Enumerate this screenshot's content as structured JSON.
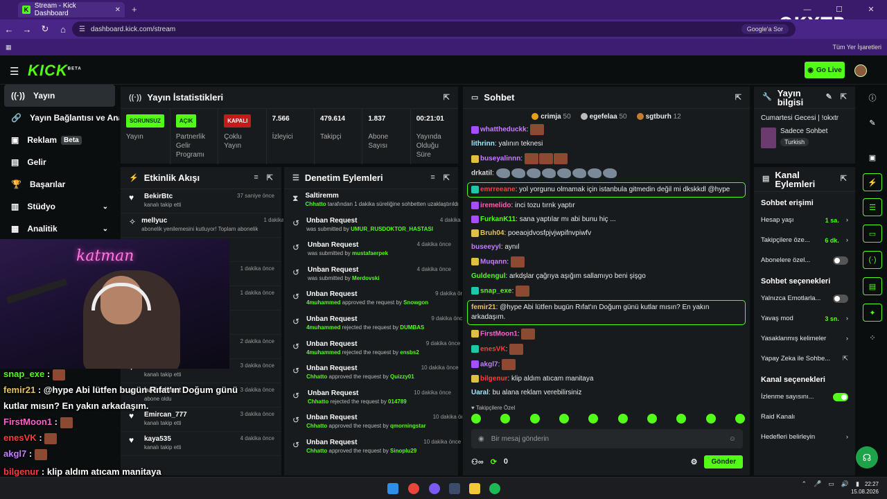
{
  "browser": {
    "tab_title": "Stream - Kick Dashboard",
    "url": "dashboard.kick.com/stream",
    "google_chip": "Google'a Sor",
    "bookmarks_label": "Tüm Yer İşaretleri"
  },
  "watermark": "OKXTR",
  "header": {
    "logo": "KICK",
    "logo_tag": "BETA",
    "go_live": "Go Live"
  },
  "nav": [
    {
      "label": "Yayın",
      "icon": "broadcast-icon"
    },
    {
      "label": "Yayın Bağlantısı ve Anahtarı",
      "icon": "link-icon"
    },
    {
      "label": "Reklam",
      "badge": "Beta",
      "icon": "ad-icon"
    },
    {
      "label": "Gelir",
      "icon": "revenue-icon"
    },
    {
      "label": "Başarılar",
      "icon": "trophy-icon"
    },
    {
      "label": "Stüdyo",
      "icon": "studio-icon"
    },
    {
      "label": "Analitik",
      "icon": "analytics-icon"
    }
  ],
  "stats": {
    "title": "Yayın İstatistikleri",
    "items": [
      {
        "value": "SORUNSUZ",
        "label": "Yayın",
        "pill": "green"
      },
      {
        "value": "AÇIK",
        "label": "Partnerlik Gelir Programı",
        "pill": "green"
      },
      {
        "value": "KAPALI",
        "label": "Çoklu Yayın",
        "pill": "red"
      },
      {
        "value": "7.566",
        "label": "İzleyici"
      },
      {
        "value": "479.614",
        "label": "Takipçi"
      },
      {
        "value": "1.837",
        "label": "Abone Sayısı"
      },
      {
        "value": "00:21:01",
        "label": "Yayında Olduğu Süre"
      }
    ]
  },
  "activity": {
    "title": "Etkinlik Akışı",
    "items": [
      {
        "name": "BekirBtc",
        "sub": "kanalı takip etti",
        "time": "37 saniye önce"
      },
      {
        "name": "mellyuc",
        "sub": "abonelik yenilemesini kutluyor! Toplam abonelik",
        "time": "1 dakika önce"
      },
      {
        "name": "",
        "sub": "",
        "time": ""
      },
      {
        "name": "",
        "sub": "",
        "time": "1 dakika önce"
      },
      {
        "name": "",
        "sub": "oplam abonelik",
        "time": "1 dakika önce"
      },
      {
        "name": "",
        "sub": "",
        "time": ""
      },
      {
        "name": "",
        "sub": "",
        "time": "2 dakika önce"
      },
      {
        "name": "Enamalol",
        "sub": "kanalı takip etti",
        "time": "3 dakika önce"
      },
      {
        "name": "barisahmet",
        "sub": "abone oldu",
        "time": "3 dakika önce"
      },
      {
        "name": "Emircan_777",
        "sub": "kanalı takip etti",
        "time": "3 dakika önce"
      },
      {
        "name": "kaya535",
        "sub": "kanalı takip etti",
        "time": "4 dakika önce"
      }
    ]
  },
  "moderation": {
    "title": "Denetim Eylemleri",
    "items": [
      {
        "title": "Saltiremm",
        "user": "Chhatto",
        "rest": " tarafından 1 dakika süreliğine sohbetten uzaklaştırıldı",
        "time": "2 dakika önce",
        "icon": "hourglass-icon"
      },
      {
        "title": "Unban Request",
        "pre": "was submitted by ",
        "user": "UMUR_RUSDOKTOR_HASTASI",
        "time": "4 dakika önce"
      },
      {
        "title": "Unban Request",
        "pre": "was submitted by ",
        "user": "mustafaerpek",
        "time": "4 dakika önce"
      },
      {
        "title": "Unban Request",
        "pre": "was submitted by ",
        "user": "Merdovski",
        "time": "4 dakika önce"
      },
      {
        "title": "Unban Request",
        "user": "4muhammed",
        "rest": " approved the request by ",
        "user2": "Snowgon",
        "time": "9 dakika önce"
      },
      {
        "title": "Unban Request",
        "user": "4muhammed",
        "rest": " rejected the request by ",
        "user2": "DUMBAS",
        "time": "9 dakika önce"
      },
      {
        "title": "Unban Request",
        "user": "4muhammed",
        "rest": " rejected the request by ",
        "user2": "ensbs2",
        "time": "9 dakika önce"
      },
      {
        "title": "Unban Request",
        "user": "Chhatto",
        "rest": " approved the request by ",
        "user2": "Quizzy01",
        "time": "10 dakika önce"
      },
      {
        "title": "Unban Request",
        "user": "Chhatto",
        "rest": " rejected the request by ",
        "user2": "014789",
        "time": "10 dakika önce"
      },
      {
        "title": "Unban Request",
        "user": "Chhatto",
        "rest": " approved the request by ",
        "user2": "qmorningstar",
        "time": "10 dakika önce"
      },
      {
        "title": "Unban Request",
        "user": "Chhatto",
        "rest": " approved the request by ",
        "user2": "Sinoplu29",
        "time": "10 dakika önce"
      }
    ]
  },
  "chat": {
    "title": "Sohbet",
    "pinned": [
      {
        "name": "crimja",
        "pts": "50"
      },
      {
        "name": "egefelaa",
        "pts": "50"
      },
      {
        "name": "sgtburh",
        "pts": "12"
      }
    ],
    "messages": [
      {
        "user": "whattheduckk",
        "color": "#c77dff",
        "text": "",
        "emotes": 1,
        "badge": "#a64dff"
      },
      {
        "user": "lithrinn",
        "color": "#9ee9ff",
        "text": "yalının teknesi"
      },
      {
        "user": "buseyalinnn",
        "color": "#c77dff",
        "text": "",
        "emotes": 3,
        "badge": "#e0c040"
      },
      {
        "user": "drkatil",
        "color": "#d8d8d8",
        "text": "",
        "birds": 8
      },
      {
        "user": "emrreeane",
        "color": "#ff3b3b",
        "text": "yol yorgunu olmamak için istanbula gitmedin değil mi dkskkdl @hype",
        "highlight": true,
        "badge": "#1fc7a8"
      },
      {
        "user": "iremelido",
        "color": "#ff5fb0",
        "text": "inci tozu tırnk yaptır",
        "badge": "#a64dff"
      },
      {
        "user": "FurkanK11",
        "color": "#53fc18",
        "text": "sana yaptılar mı abi bunu hiç ...",
        "badge": "#a64dff"
      },
      {
        "user": "Bruh04",
        "color": "#e6c35a",
        "text": "poeaojdvosfpjvjwpifnvpiwfv",
        "badge": "#e0c040"
      },
      {
        "user": "buseeyyl",
        "color": "#c77dff",
        "text": "aynıl"
      },
      {
        "user": "Muqann",
        "color": "#c77dff",
        "text": "",
        "emotes": 1,
        "badge": "#e0c040"
      },
      {
        "user": "Guldengul",
        "color": "#53fc18",
        "text": "arkdşlar çağrıya aşığım sallamıyo beni şişgo"
      },
      {
        "user": "snap_exe",
        "color": "#53fc18",
        "text": "",
        "emotes": 1,
        "badge": "#1fc7a8"
      },
      {
        "user": "femir21",
        "color": "#e6c35a",
        "text": "@hype Abi lütfen bugün Rıfat'ın Doğum günü kutlar mısın? En yakın arkadaşım.",
        "highlight": true
      },
      {
        "user": "FirstMoon1",
        "color": "#ff5fd0",
        "text": "",
        "emotes": 1,
        "badge": "#e0c040"
      },
      {
        "user": "enesVK",
        "color": "#ff3b3b",
        "text": "",
        "emotes": 1,
        "badge": "#1fc7a8"
      },
      {
        "user": "akgl7",
        "color": "#c77dff",
        "text": "",
        "emotes": 1,
        "badge": "#a64dff"
      },
      {
        "user": "bilgenur",
        "color": "#ff3b3b",
        "text": "klip aldım atıcam manitaya",
        "badge": "#e0c040"
      },
      {
        "user": "Uaral",
        "color": "#9ee9ff",
        "text": "bu alana reklam verebilirsiniz"
      }
    ],
    "subs_only": "Takipçilere Özel",
    "input_placeholder": "Bir mesaj gönderin",
    "count": "0",
    "send": "Gönder"
  },
  "stream_info": {
    "title": "Yayın bilgisi",
    "stream_title": "Cumartesi Gecesi | !okxtr",
    "category": "Sadece Sohbet",
    "language": "Turkish"
  },
  "channel_actions": {
    "title": "Kanal Eylemleri",
    "chat_access": "Sohbet erişimi",
    "rows1": [
      {
        "label": "Hesap yaşı",
        "value": "1 sa."
      },
      {
        "label": "Takipçilere öze...",
        "value": "6 dk."
      },
      {
        "label": "Abonelere özel...",
        "toggle": "off"
      }
    ],
    "chat_options": "Sohbet seçenekleri",
    "rows2": [
      {
        "label": "Yalnızca Emotlarla...",
        "toggle": "off"
      },
      {
        "label": "Yavaş mod",
        "value": "3 sn."
      },
      {
        "label": "Yasaklanmış kelimeler",
        "arrow": true
      },
      {
        "label": "Yapay Zeka ile Sohbe...",
        "ext": true
      }
    ],
    "channel_options": "Kanal seçenekleri",
    "rows3": [
      {
        "label": "İzlenme sayısını...",
        "toggle": "on"
      },
      {
        "label": "Raid Kanalı"
      },
      {
        "label": "Hedefleri belirleyin",
        "arrow": true
      }
    ]
  },
  "overlay": [
    {
      "user": "snap_exe",
      "text": " : ",
      "emote": true,
      "color": "#53fc18"
    },
    {
      "user": "femir21",
      "text": " : @hype Abi lütfen bugün Rıfat'ın Doğum günü",
      "color": "#e6c35a"
    },
    {
      "user": "",
      "text": "kutlar mısın? En yakın arkadaşım.",
      "color": "#fff"
    },
    {
      "user": "FirstMoon1",
      "text": " : ",
      "emote": true,
      "color": "#ff5fd0"
    },
    {
      "user": "enesVK",
      "text": " : ",
      "emote": true,
      "color": "#ff3b3b"
    },
    {
      "user": "akgl7",
      "text": " : ",
      "emote": true,
      "color": "#c77dff"
    },
    {
      "user": "bilgenur",
      "text": " : klip aldım atıcam manitaya",
      "color": "#ff3b3b"
    },
    {
      "user": "Uaral",
      "text": " : bu alana reklam verebilirsiniz",
      "color": "#9ee9ff"
    }
  ],
  "cam_neon": "katman",
  "clock": {
    "time": "22:27",
    "date": "15.08.2026"
  },
  "colors": {
    "accent": "#53fc18",
    "panel": "#181b1d",
    "bg": "#0b0e0f"
  }
}
